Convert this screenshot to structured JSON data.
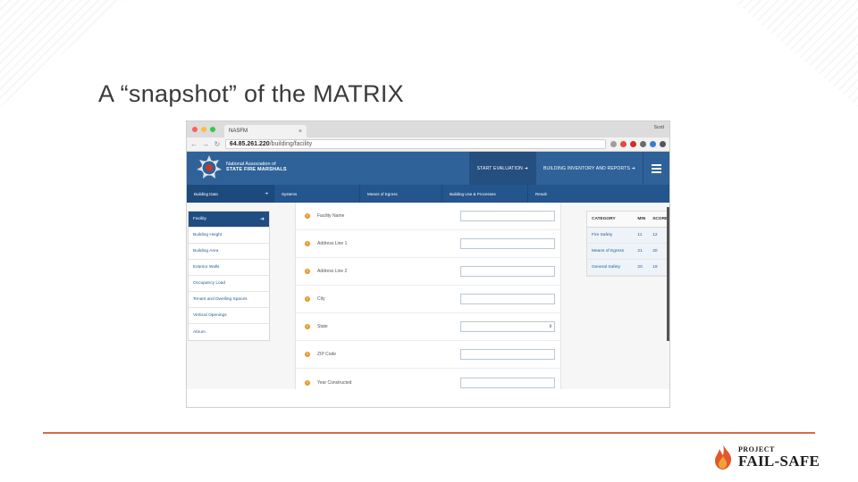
{
  "slide": {
    "title": "A “snapshot” of the MATRIX"
  },
  "logo": {
    "line1": "PROJECT",
    "line2": "FAIL-SAFE",
    "accent": "#d66a4a"
  },
  "browser": {
    "tab_title": "NASFM",
    "user": "Scott",
    "url_host": "64.85.261.220",
    "url_path": "/building/facility"
  },
  "app": {
    "org_line1": "National Association of",
    "org_line2": "STATE FIRE MARSHALS",
    "start_evaluation": "START EVALUATION ➜",
    "building_inventory": "BUILDING INVENTORY AND REPORTS ➜",
    "brand_color": "#2f6299"
  },
  "sections": [
    {
      "label": "Building Data",
      "arrow": "➜"
    },
    {
      "label": "Systems"
    },
    {
      "label": "Means of Egress"
    },
    {
      "label": "Building Use & Processes"
    },
    {
      "label": "Result"
    }
  ],
  "leftnav": [
    {
      "label": "Facility",
      "arrow": "➜"
    },
    {
      "label": "Building Height"
    },
    {
      "label": "Building Area"
    },
    {
      "label": "Exterior Walls"
    },
    {
      "label": "Occupancy Load"
    },
    {
      "label": "Tenant and Dwelling Spaces"
    },
    {
      "label": "Vertical Openings"
    },
    {
      "label": "Atrium"
    }
  ],
  "form": {
    "fields": [
      {
        "label": "Facility Name",
        "type": "text"
      },
      {
        "label": "Address Line 1",
        "type": "text"
      },
      {
        "label": "Address Line 2",
        "type": "text"
      },
      {
        "label": "City",
        "type": "text"
      },
      {
        "label": "State",
        "type": "select",
        "value": ""
      },
      {
        "label": "ZIP Code",
        "type": "text"
      },
      {
        "label": "Year Constructed",
        "type": "text"
      }
    ]
  },
  "scores": {
    "headers": [
      "CATEGORY",
      "MIN",
      "SCORE"
    ],
    "rows": [
      {
        "category": "Fire Safety",
        "min": "11",
        "score": "12"
      },
      {
        "category": "Means of Egress",
        "min": "21",
        "score": "20"
      },
      {
        "category": "General Safety",
        "min": "20",
        "score": "19"
      }
    ]
  }
}
